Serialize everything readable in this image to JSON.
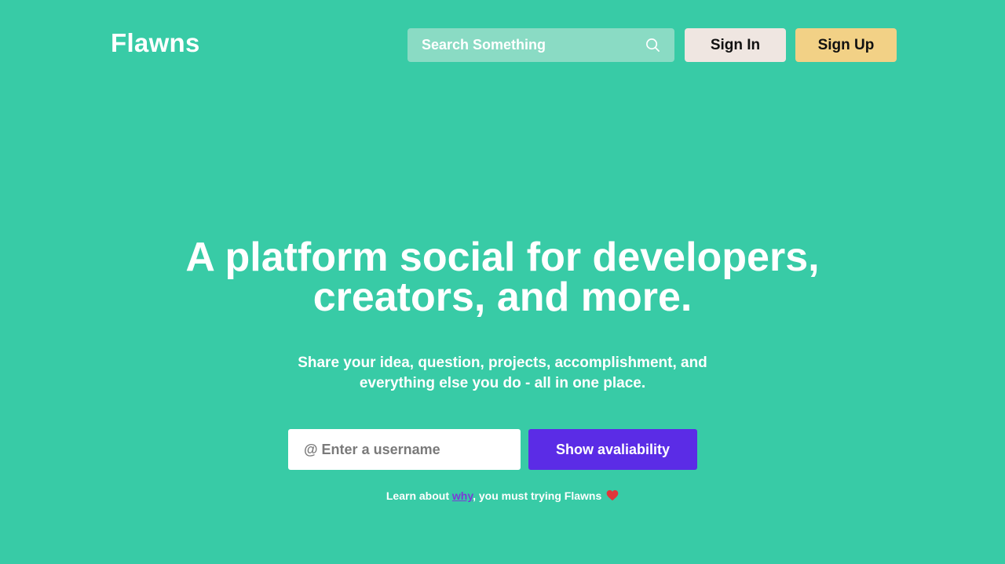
{
  "header": {
    "logo": "Flawns",
    "search": {
      "placeholder": "Search Something",
      "icon": "search-icon"
    },
    "sign_in_label": "Sign In",
    "sign_up_label": "Sign Up"
  },
  "hero": {
    "title_line1": "A platform social for developers,",
    "title_line2": "creators, and more.",
    "subtitle_line1": "Share your idea, question, projects, accomplishment, and",
    "subtitle_line2": "everything else you do - all in one place."
  },
  "signup": {
    "username_placeholder": "@ Enter a username",
    "availability_label": "Show avaliability"
  },
  "learn": {
    "prefix": "Learn about ",
    "link": "why",
    "suffix": ", you must trying Flawns",
    "icon": "heart-icon"
  },
  "colors": {
    "background": "#38cba6",
    "search_bg": "#8adbc4",
    "sign_in_bg": "#efe6e1",
    "sign_up_bg": "#f2d186",
    "primary": "#5b2ce6",
    "link": "#7b3bd6",
    "heart": "#e0363a"
  }
}
